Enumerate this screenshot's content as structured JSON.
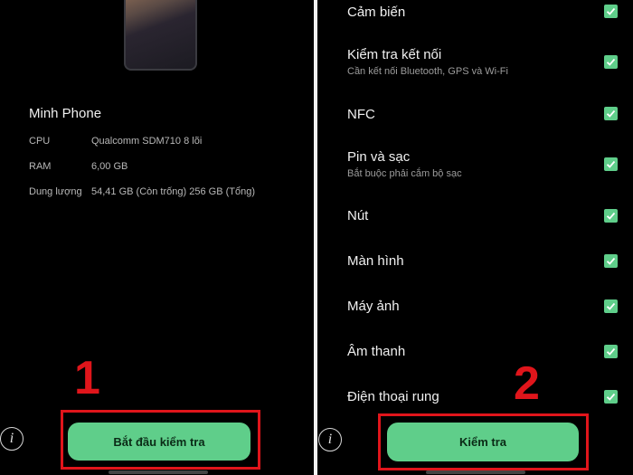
{
  "left": {
    "device_name": "Minh Phone",
    "specs": [
      {
        "key": "CPU",
        "value": "Qualcomm SDM710 8 lõi"
      },
      {
        "key": "RAM",
        "value": "6,00 GB"
      },
      {
        "key": "Dung lượng",
        "value": "54,41 GB (Còn trống) 256 GB (Tổng)"
      }
    ],
    "step_number": "1",
    "start_button": "Bắt đầu kiểm tra",
    "info_icon": "i"
  },
  "right": {
    "items": [
      {
        "label": "Cảm biến",
        "sub": "",
        "checked": true
      },
      {
        "label": "Kiểm tra kết nối",
        "sub": "Cần kết nối Bluetooth, GPS và Wi-Fi",
        "checked": true
      },
      {
        "label": "NFC",
        "sub": "",
        "checked": true
      },
      {
        "label": "Pin và sạc",
        "sub": "Bắt buộc phải cắm bộ sạc",
        "checked": true
      },
      {
        "label": "Nút",
        "sub": "",
        "checked": true
      },
      {
        "label": "Màn hình",
        "sub": "",
        "checked": true
      },
      {
        "label": "Máy ảnh",
        "sub": "",
        "checked": true
      },
      {
        "label": "Âm thanh",
        "sub": "",
        "checked": true
      },
      {
        "label": "Điện thoại rung",
        "sub": "",
        "checked": true
      }
    ],
    "step_number": "2",
    "check_button": "Kiểm tra",
    "info_icon": "i"
  },
  "colors": {
    "accent_green": "#5fce8a",
    "highlight_red": "#e0151b"
  }
}
